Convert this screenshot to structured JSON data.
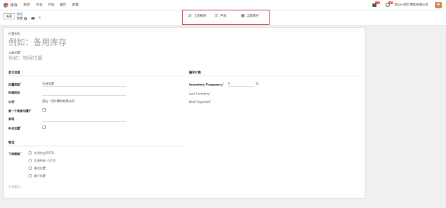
{
  "navbar": {
    "app_name": "库存",
    "menu": [
      "概述",
      "作业",
      "产品",
      "报告",
      "配置"
    ],
    "chat_badge": "25",
    "activity_badge": "40",
    "company": "昆山一回计算机有限公司"
  },
  "control": {
    "new_label": "新建",
    "breadcrumb_parent": "地点",
    "breadcrumb_current": "新建"
  },
  "smart_buttons": [
    {
      "icon": "shuffle-icon",
      "label": "上架规则"
    },
    {
      "icon": "list-icon",
      "label": "产品"
    },
    {
      "icon": "boxes-icon",
      "label": "当前库存"
    }
  ],
  "form": {
    "location_name_label": "位置名称",
    "location_name_placeholder": "例如：备用库存",
    "parent_label": "上级位置",
    "parent_placeholder": "例如：物理位置",
    "other_section": "其它信息",
    "location_type_label": "位置类型",
    "location_type_value": "内部位置",
    "storage_category_label": "存储类别",
    "company_label": "公司",
    "company_value": "昆山一回计算机有限公司",
    "scrap_label": "是一个报废位置?",
    "barcode_label": "条码",
    "replenish_label": "补充位置",
    "cyclic_section": "循环计数",
    "inventory_freq_label": "Inventory Frequency",
    "inventory_freq_value": "0",
    "inventory_freq_unit": "天",
    "last_inventory_label": "Last Inventory",
    "next_expected_label": "Next Expected",
    "logistics_section": "物流",
    "removal_label": "下架策略",
    "removal_options": [
      "先进先出(FIFO)",
      "后进先出（LIFO）",
      "最近位置",
      "最少包裹"
    ],
    "notes_placeholder": "外部备注..."
  }
}
